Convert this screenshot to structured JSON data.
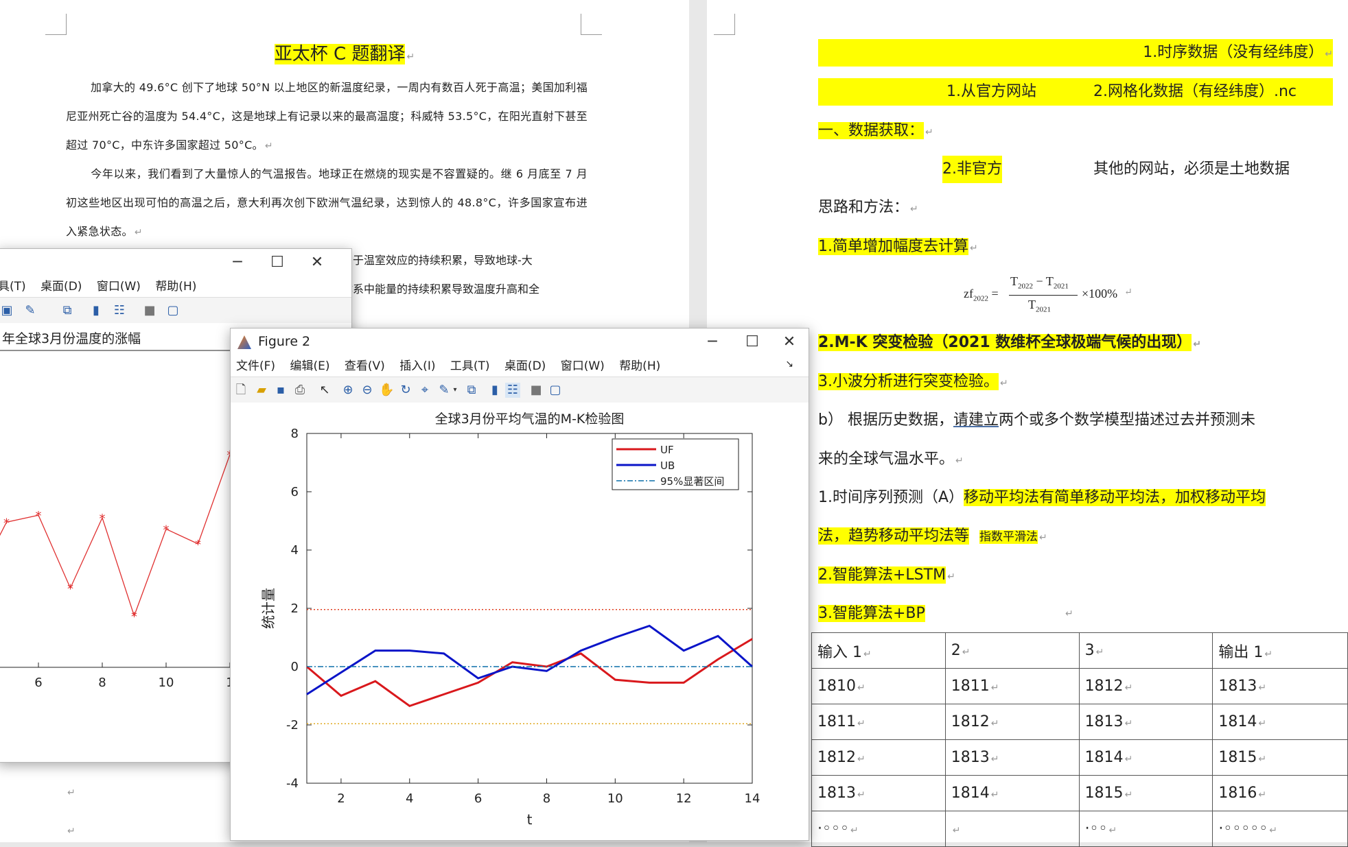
{
  "left_doc": {
    "title": "亚太杯 C 题翻译",
    "para1": "加拿大的 49.6°C 创下了地球 50°N 以上地区的新温度纪录，一周内有数百人死于高温；美国加利福尼亚州死亡谷的温度为 54.4°C，这是地球上有记录以来的最高温度；科威特 53.5°C，在阳光直射下甚至超过 70°C，中东许多国家超过 50°C。",
    "para2": "今年以来，我们看到了大量惊人的气温报告。地球正在燃烧的现实是不容置疑的。继 6 月底至 7 月初这些地区出现可怕的高温之后，意大利再次创下欧洲气温纪录，达到惊人的 48.8°C，许多国家宣布进入紧急状态。",
    "para3_frag1": "由于温室效应的持续积累，导致地球-大",
    "para3_frag2": "体系中能量的持续积累导致温度升高和全",
    "para_mark": "↵"
  },
  "right_doc": {
    "line1": "1.时序数据（没有经纬度）",
    "line2a": "1.从官方网站",
    "line2b": "2.网格化数据（有经纬度）.nc",
    "line3": "一、数据获取：",
    "line4a": "2.非官方",
    "line4b": "其他的网站，必须是土地数据",
    "line5": "思路和方法：",
    "line6": "1.简单增加幅度去计算",
    "formula": "zf2022 = (T2022 − T2021) / T2021 × 100%",
    "line7": "2.M-K 突变检验（2021 数维杯全球极端气候的出现）",
    "line8": "3.小波分析进行突变检验。",
    "line9a": "b） 根据历史数据，",
    "line9b": "请建立",
    "line9c": "两个或多个数学模型描述过去并预测未",
    "line10": "来的全球气温水平。",
    "line11a": "1.时间序列预测（A）",
    "line11b": "移动平均法有简单移动平均法，加权移动平均",
    "line12a": "法，趋势移动平均法等",
    "line12b": "指数平滑法",
    "line13": "2.智能算法+LSTM",
    "line14": "3.智能算法+BP",
    "table": [
      [
        "输入 1",
        "2",
        "3",
        "输出 1"
      ],
      [
        "1810",
        "1811",
        "1812",
        "1813"
      ],
      [
        "1811",
        "1812",
        "1813",
        "1814"
      ],
      [
        "1812",
        "1813",
        "1814",
        "1815"
      ],
      [
        "1813",
        "1814",
        "1815",
        "1816"
      ],
      [
        "·◦◦◦",
        "",
        "·◦◦",
        "·◦◦◦◦◦"
      ]
    ]
  },
  "fig1": {
    "menu": [
      "具(T)",
      "桌面(D)",
      "窗口(W)",
      "帮助(H)"
    ],
    "title_partial": "年全球3月份温度的涨幅",
    "xtick_labels": [
      "6",
      "8",
      "10",
      "1"
    ],
    "color": "#e03030"
  },
  "fig2": {
    "window_title": "Figure 2",
    "menu": [
      "文件(F)",
      "编辑(E)",
      "查看(V)",
      "插入(I)",
      "工具(T)",
      "桌面(D)",
      "窗口(W)",
      "帮助(H)"
    ]
  },
  "chart_data": [
    {
      "type": "line",
      "title": "全球3月份平均气温的M-K检验图",
      "xlabel": "t",
      "ylabel": "统计量",
      "xlim": [
        1,
        14
      ],
      "ylim": [
        -4,
        8
      ],
      "xticks": [
        2,
        4,
        6,
        8,
        10,
        12,
        14
      ],
      "yticks": [
        -4,
        -2,
        0,
        2,
        4,
        6,
        8
      ],
      "legend_position": "top-right",
      "x": [
        1,
        2,
        3,
        4,
        5,
        6,
        7,
        8,
        9,
        10,
        11,
        12,
        13,
        14
      ],
      "series": [
        {
          "name": "UF",
          "color": "#d9181c",
          "values": [
            0,
            -1.0,
            -0.5,
            -1.35,
            -0.95,
            -0.55,
            0.15,
            0.0,
            0.45,
            -0.45,
            -0.55,
            -0.55,
            0.25,
            0.95
          ]
        },
        {
          "name": "UB",
          "color": "#0a14c8",
          "values": [
            -0.95,
            -0.2,
            0.55,
            0.55,
            0.45,
            -0.4,
            0.0,
            -0.15,
            0.55,
            1.0,
            1.4,
            0.55,
            1.05,
            0.0
          ]
        },
        {
          "name": "95%显著区间",
          "color": "#0a6fa8",
          "values": [
            0,
            0,
            0,
            0,
            0,
            0,
            0,
            0,
            0,
            0,
            0,
            0,
            0,
            0
          ]
        }
      ],
      "reference_lines": [
        {
          "y": 1.96,
          "color": "#e03c1e"
        },
        {
          "y": -1.96,
          "color": "#e0a81e"
        }
      ]
    },
    {
      "type": "line",
      "title": "年全球3月份温度的涨幅",
      "x": [
        4,
        5,
        6,
        7,
        8,
        9,
        10,
        11,
        12
      ],
      "series": [
        {
          "name": "",
          "color": "#e03030",
          "values": [
            2.0,
            5.6,
            6.0,
            1.8,
            5.85,
            0.2,
            5.2,
            4.35,
            9.5
          ]
        }
      ]
    }
  ]
}
